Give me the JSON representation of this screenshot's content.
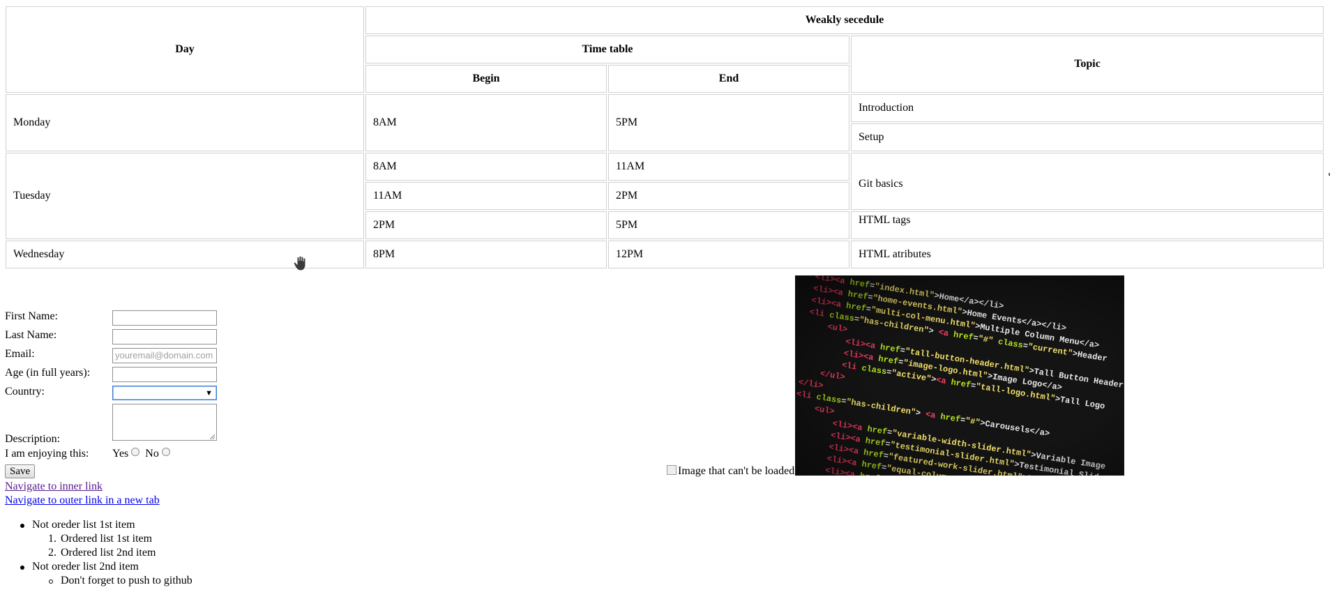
{
  "schedule": {
    "header": {
      "day": "Day",
      "weekly": "Weakly secedule",
      "time_table": "Time table",
      "topic": "Topic",
      "begin": "Begin",
      "end": "End"
    },
    "rows": {
      "monday": {
        "day": "Monday",
        "begin": "8AM",
        "end": "5PM",
        "topic1": "Introduction",
        "topic2": "Setup"
      },
      "tuesday": {
        "day": "Tuesday",
        "slots": [
          {
            "begin": "8AM",
            "end": "11AM"
          },
          {
            "begin": "11AM",
            "end": "2PM"
          },
          {
            "begin": "2PM",
            "end": "5PM"
          }
        ],
        "topic1": "Git basics",
        "topic2": "HTML tags"
      },
      "wednesday": {
        "day": "Wednesday",
        "begin": "8PM",
        "end": "12PM",
        "topic": "HTML atributes"
      }
    }
  },
  "form": {
    "first_name_label": "First Name:",
    "last_name_label": "Last Name:",
    "email_label": "Email:",
    "email_placeholder": "youremail@domain.com",
    "age_label": "Age (in full years):",
    "country_label": "Country:",
    "description_label": "Description:",
    "enjoying_label": "I am enjoying this:",
    "yes_label": "Yes",
    "no_label": "No",
    "save_label": "Save"
  },
  "links": {
    "inner": "Navigate to inner link",
    "outer": "Navigate to outer link in a new tab"
  },
  "lists": {
    "ul_item1": "Not oreder list 1st item",
    "ol_item1": "Ordered list 1st item",
    "ol_item2": "Ordered list 2nd item",
    "ul_item2": "Not oreder list 2nd item",
    "sub_item": "Don't forget to push to github"
  },
  "images": {
    "broken_alt": "Image that can't be loaded"
  },
  "colors": {
    "link_unvisited": "#0000ee",
    "link_visited": "#551a8b",
    "table_border": "#d0d0d0"
  }
}
